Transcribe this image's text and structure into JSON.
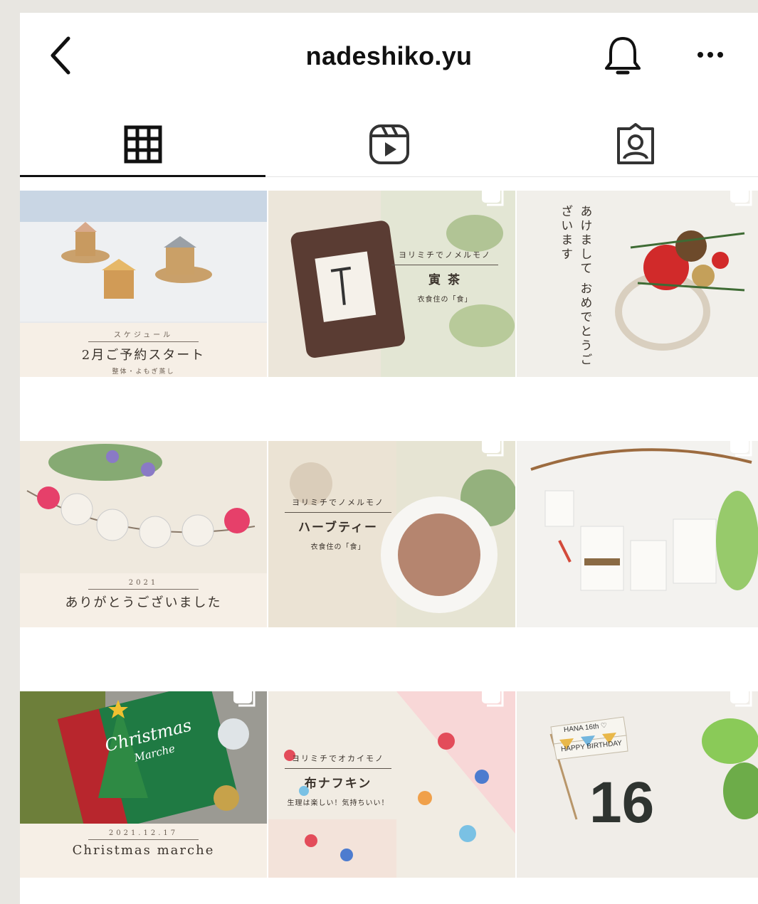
{
  "header": {
    "title": "nadeshiko.yu"
  },
  "icons": {
    "back": "chevron-left-icon",
    "bell": "bell-icon",
    "more": "more-horizontal-icon",
    "grid": "grid-icon",
    "reels": "reels-icon",
    "tagged": "tagged-user-icon"
  },
  "posts": [
    {
      "small": "スケジュール",
      "main": "2月ご予約スタート",
      "sub": "整体・よもぎ蒸し"
    },
    {
      "small": "ヨリミチでノメルモノ",
      "main": "寅 茶",
      "sub": "衣食住の「食」"
    },
    {
      "vertical_1": "あけまして",
      "vertical_2": "おめでとうございます"
    },
    {
      "small": "2021",
      "main": "ありがとうございました"
    },
    {
      "small": "ヨリミチでノメルモノ",
      "main": "ハーブティー",
      "sub": "衣食住の「食」"
    },
    {},
    {
      "card_title": "Christmas",
      "card_sub": "Marche",
      "small": "2021.12.17",
      "main": "Christmas marche"
    },
    {
      "small": "ヨリミチでオカイモノ",
      "main": "布ナフキン",
      "sub": "生理は楽しい！気持ちいい！"
    },
    {
      "flag_1": "HANA 16th ♡",
      "flag_2": "HAPPY BIRTHDAY",
      "number": "16"
    }
  ],
  "colors": {
    "accent": "#111111",
    "caption_band": "#f6efe6"
  }
}
